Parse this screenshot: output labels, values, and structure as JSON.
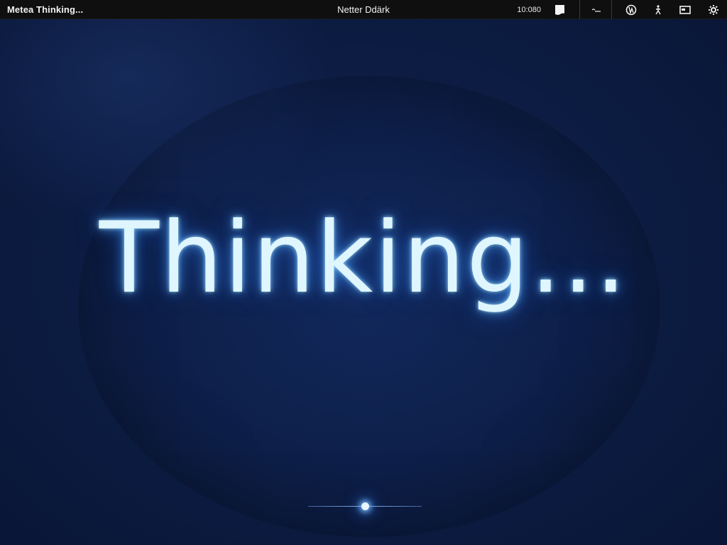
{
  "topbar": {
    "left_title": "Metea Thinking...",
    "center_title": "Netter Ddärk",
    "clock": "10:080",
    "icons": [
      "document-icon",
      "network-icon",
      "globe-icon",
      "accessibility-icon",
      "display-icon",
      "settings-icon"
    ]
  },
  "stage": {
    "headline": "Thinking...",
    "progress": 0.5
  },
  "colors": {
    "background": "#0b1a3e",
    "glow": "#dff6ff",
    "topbar": "#0f0f10"
  }
}
